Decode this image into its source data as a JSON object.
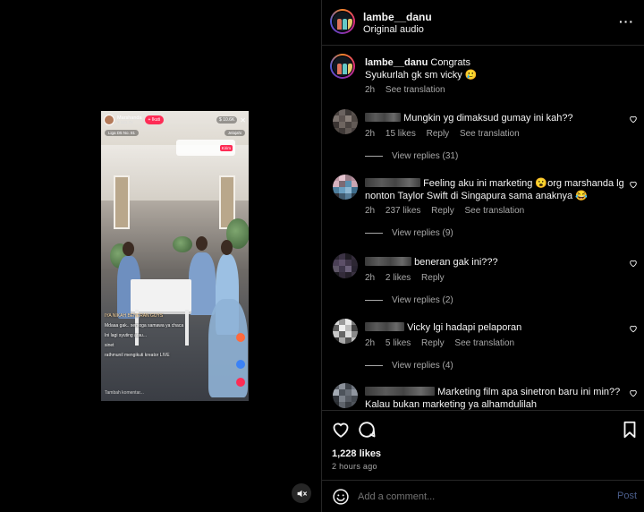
{
  "post": {
    "username": "lambe__danu",
    "audio": "Original audio"
  },
  "caption": {
    "username": "lambe__danu",
    "line1": "Congrats",
    "line2": "Syukurlah gk sm vicky 🥲",
    "time": "2h",
    "translate": "See translation"
  },
  "comments": [
    {
      "text": "Mungkin yg dimaksud gumay ini kah??",
      "time": "2h",
      "likes": "15 likes",
      "reply": "Reply",
      "translate": "See translation",
      "view_replies": "View replies (31)"
    },
    {
      "text": "Feeling aku ini marketing 😮org marshanda lg nonton Taylor Swift di Singapura sama anaknya 😂",
      "time": "2h",
      "likes": "237 likes",
      "reply": "Reply",
      "translate": "See translation",
      "view_replies": "View replies (9)"
    },
    {
      "text": "beneran gak ini???",
      "time": "2h",
      "likes": "2 likes",
      "reply": "Reply",
      "translate": "",
      "view_replies": "View replies (2)"
    },
    {
      "text": "Vicky lgi hadapi pelaporan",
      "time": "2h",
      "likes": "5 likes",
      "reply": "Reply",
      "translate": "See translation",
      "view_replies": "View replies (4)"
    },
    {
      "text": "Marketing film apa sinetron baru ini min?? Kalau bukan marketing ya alhamdulilah",
      "time": "",
      "likes": "",
      "reply": "",
      "translate": "",
      "view_replies": ""
    }
  ],
  "actions": {
    "likes": "1,228 likes",
    "time": "2 hours ago"
  },
  "add_comment": {
    "placeholder": "Add a comment...",
    "post": "Post"
  },
  "video": {
    "streamer": "Marshanda",
    "followers": "♥ 221.7K",
    "follow": "+ Ikuti",
    "viewers": "$ 10.6K",
    "league": "Liga D5 No. 81",
    "explore": "Jelajahi",
    "gift_label": "Kirim",
    "chat": [
      "IYA NIKAH BENERAN GUYS",
      "Mdaaa gak.. semoga samawa ya chaca",
      "Ini lagi syuting atau...",
      "sinet",
      "rathmunil mengikuti kreator LIVE"
    ],
    "comment_bar": "Tambah komentar..."
  },
  "colors": {
    "accent": "#0095f6",
    "muted": "#a8a8a8",
    "divider": "#262626",
    "live_red": "#fe2c55"
  }
}
